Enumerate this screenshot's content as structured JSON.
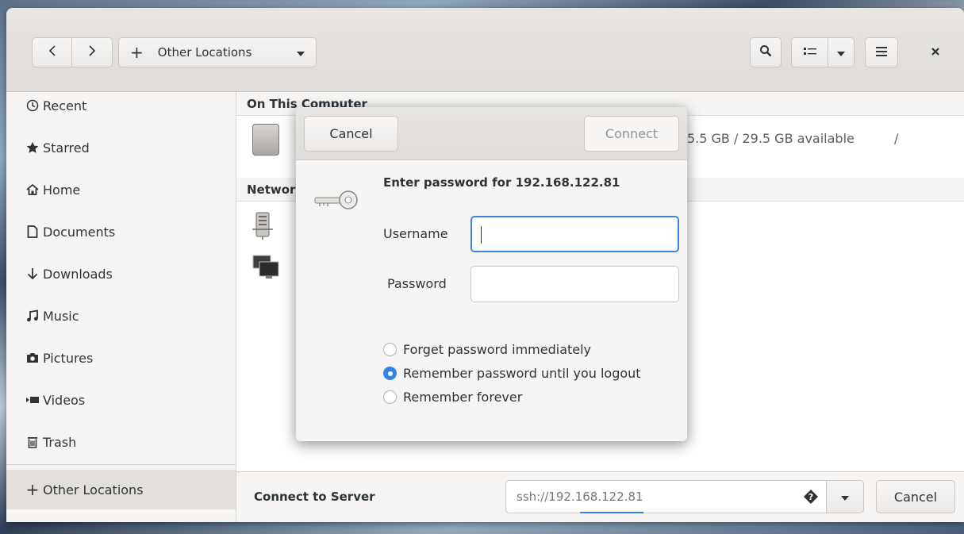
{
  "header": {
    "location_label": "Other Locations",
    "plus_glyph": "+"
  },
  "sidebar": {
    "items": [
      {
        "label": "Recent",
        "icon": "clock-icon"
      },
      {
        "label": "Starred",
        "icon": "star-icon"
      },
      {
        "label": "Home",
        "icon": "home-icon"
      },
      {
        "label": "Documents",
        "icon": "document-icon"
      },
      {
        "label": "Downloads",
        "icon": "download-icon"
      },
      {
        "label": "Music",
        "icon": "music-icon"
      },
      {
        "label": "Pictures",
        "icon": "camera-icon"
      },
      {
        "label": "Videos",
        "icon": "video-icon"
      },
      {
        "label": "Trash",
        "icon": "trash-icon"
      }
    ],
    "other_locations": "Other Locations"
  },
  "main": {
    "on_this_computer": "On This Computer",
    "disk_info": "5.5 GB / 29.5 GB available",
    "disk_path": "/",
    "networks": "Networ"
  },
  "footer": {
    "connect_label": "Connect to Server",
    "server_address": "ssh://192.168.122.81",
    "cancel_label": "Cancel"
  },
  "dialog": {
    "cancel_label": "Cancel",
    "connect_label": "Connect",
    "title": "Enter password for 192.168.122.81",
    "username_label": "Username",
    "username_value": "",
    "password_label": "Password",
    "password_value": "",
    "options": [
      {
        "label": "Forget password immediately",
        "selected": false
      },
      {
        "label": "Remember password until you logout",
        "selected": true
      },
      {
        "label": "Remember forever",
        "selected": false
      }
    ]
  },
  "colors": {
    "accent": "#3584e4",
    "headerbar": "#e8e6e3",
    "sidebar": "#f6f5f4"
  }
}
